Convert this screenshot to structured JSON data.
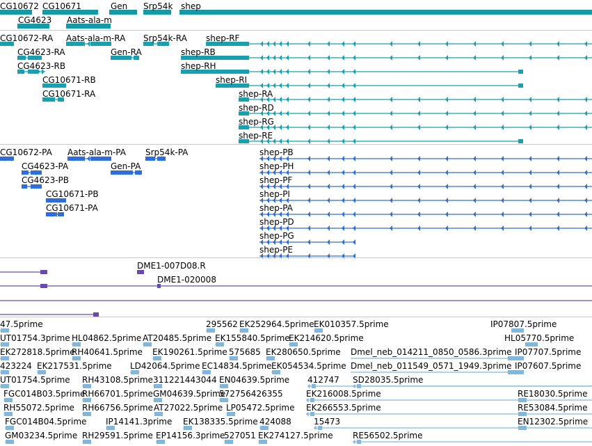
{
  "colors": {
    "gene": "#1598a8",
    "transcript": "#16a0b0",
    "protein": "#2d6fd8",
    "clone": "#6a4ab0",
    "est": "#82b7dd",
    "separator": "#c8c8c8"
  },
  "genes": [
    "CG10672",
    "CG10671",
    "Gen",
    "Srp54k",
    "shep",
    "CG4623",
    "Aats-ala-m"
  ],
  "transcripts": [
    "CG10672-RA",
    "Aats-ala-m-RA",
    "Srp54k-RA",
    "shep-RF",
    "CG4623-RA",
    "Gen-RA",
    "shep-RB",
    "CG4623-RB",
    "shep-RH",
    "CG10671-RB",
    "shep-RI",
    "CG10671-RA",
    "shep-RA",
    "shep-RD",
    "shep-RG",
    "shep-RE"
  ],
  "proteins": [
    "CG10672-PA",
    "Aats-ala-m-PA",
    "Srp54k-PA",
    "shep-PB",
    "CG4623-PA",
    "Gen-PA",
    "shep-PH",
    "CG4623-PB",
    "shep-PF",
    "CG10671-PB",
    "shep-PI",
    "CG10671-PA",
    "shep-PA",
    "shep-PD",
    "shep-PG",
    "shep-PE"
  ],
  "clones": [
    "DME1-007D08.R",
    "DME1-020008"
  ],
  "ests": [
    "47.5prime",
    "295562",
    "EK252964.5prime",
    "EK010357.5prime",
    "IP07807.5prime",
    "UT01754.3prime",
    "HL04862.5prime",
    "AT20485.5prime",
    "EK155840.5prime",
    "EK214620.5prime",
    "HL05770.5prime",
    "EK272818.5prime",
    "RH40641.5prime",
    "EK190261.5prime",
    "575685",
    "EK280650.5prime",
    "Dmel_neb_014211_0850_0586.3prime",
    "IP07707.5prime",
    "423224",
    "EK217531.5prime",
    "LD42064.5prime",
    "EC14834.5prime",
    "EK054534.5prime",
    "Dmel_neb_011549_0571_1949.3prime",
    "IP07607.5prime",
    "UT01754.5prime",
    "RH43108.5prime",
    "311221443044",
    "EN04639.5prime",
    "412747",
    "SD28035.5prime",
    "FGC014B03.5prime",
    "RH66701.5prime",
    "GM04639.5prime",
    "572756426355",
    "EK216008.5prime",
    "RE18030.5prime",
    "RH55072.5prime",
    "RH66756.5prime",
    "AT27022.5prime",
    "LP05472.5prime",
    "EK266553.5prime",
    "RE53084.5prime",
    "FGC014B04.5prime",
    "IP14141.3prime",
    "EK138335.5prime",
    "424088",
    "15473",
    "EN12302.5prime",
    "GM03234.5prime",
    "RH29591.5prime",
    "EP14156.3prime",
    "527051",
    "EK274127.5prime",
    "RE56502.5prime"
  ]
}
